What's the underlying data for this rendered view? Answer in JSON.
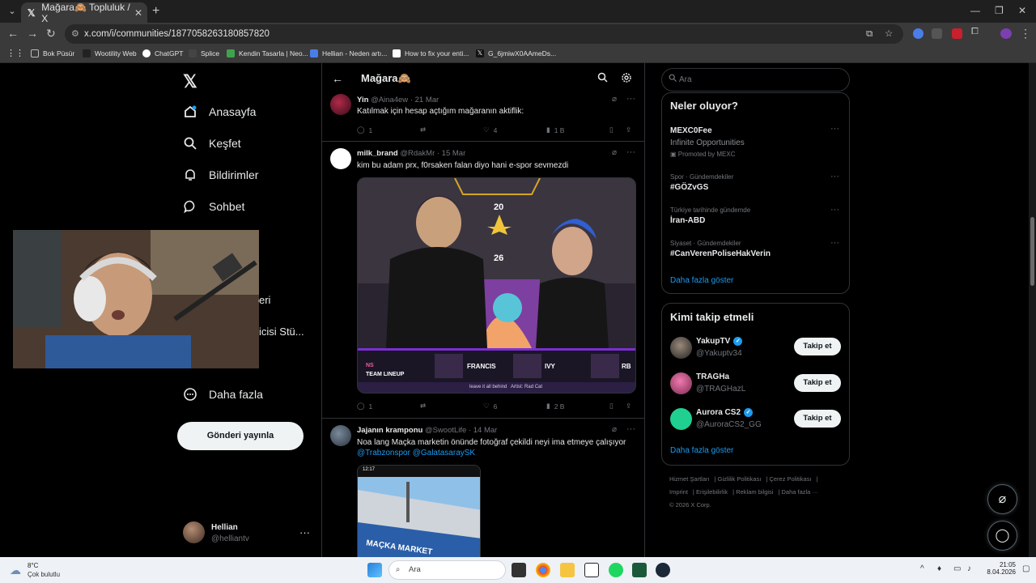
{
  "browser": {
    "tab_title": "Mağara🙈 Topluluk / X",
    "url": "x.com/i/communities/1877058263180857820",
    "bookmarks": [
      "Bok Püsür",
      "Wootility Web",
      "ChatGPT",
      "Splice",
      "Kendin Tasarla | Neo...",
      "Hellian - Neden artı...",
      "How to fix your enti...",
      "G_6jmiwX0AAmeDs..."
    ]
  },
  "sidebar": {
    "logo": "𝕏",
    "items": [
      {
        "label": "Anasayfa",
        "icon": "home-icon"
      },
      {
        "label": "Keşfet",
        "icon": "search-icon"
      },
      {
        "label": "Bildirimler",
        "icon": "bell-icon"
      },
      {
        "label": "Sohbet",
        "icon": "chat-icon"
      },
      {
        "label": "Daha fazla",
        "icon": "more-circle-icon"
      }
    ],
    "obscured_fragments": [
      "eri",
      "icisi Stü..."
    ],
    "post_button": "Gönderi yayınla",
    "profile": {
      "name": "Hellian",
      "handle": "@helliantv",
      "more": "···"
    }
  },
  "feed": {
    "title": "Mağara🙈",
    "tweets": [
      {
        "name": "Yin",
        "handle": "@Aina4ew",
        "date": "· 21 Mar",
        "text": "Katılmak için hesap açtığım mağaranın aktiflik:",
        "replies": "1",
        "likes": "4",
        "views": "1 B"
      },
      {
        "name": "milk_brand",
        "handle": "@RdakMr",
        "date": "· 15 Mar",
        "text": "kim bu adam prx, f0rsaken falan diyo hani e-spor sevmezdi",
        "media": {
          "score_top": "20",
          "score_bottom": "26",
          "team_label": "TEAM LINEUP",
          "team_code": "NS",
          "players": [
            "FRANCIS",
            "IVY",
            "RB"
          ],
          "ticker": "leave it all behind   Artist: Rad Cat"
        },
        "replies": "1",
        "likes": "6",
        "views": "2 B"
      },
      {
        "name": "Jajanın kramponu",
        "handle": "@SwootLife",
        "date": "· 14 Mar",
        "text": "Noa lang Maçka marketin önünde fotoğraf çekildi neyi ima etmeye çalışıyor",
        "mentions": "@Trabzonspor @GalatasaraySK",
        "media": {
          "status_time": "12:17",
          "sign": "MAÇKA MARKET"
        }
      }
    ]
  },
  "right": {
    "search_placeholder": "Ara",
    "trends_title": "Neler oluyor?",
    "trends": [
      {
        "meta": "",
        "name": "MEXC0Fee",
        "sub": "Infinite Opportunities",
        "promo": "Promoted by MEXC"
      },
      {
        "meta": "Spor · Gündemdekiler",
        "name": "#GÖZvGS"
      },
      {
        "meta": "Türkiye tarihinde gündemde",
        "name": "İran-ABD"
      },
      {
        "meta": "Siyaset · Gündemdekiler",
        "name": "#CanVerenPoliseHakVerin"
      }
    ],
    "trends_show_more": "Daha fazla göster",
    "follow_title": "Kimi takip etmeli",
    "follow": [
      {
        "name": "YakupTV",
        "handle": "@Yakuptv34",
        "verified": true,
        "button": "Takip et"
      },
      {
        "name": "TRAGHa",
        "handle": "@TRAGHazL",
        "verified": false,
        "button": "Takip et"
      },
      {
        "name": "Aurora CS2",
        "handle": "@AuroraCS2_GG",
        "verified": true,
        "button": "Takip et"
      }
    ],
    "follow_show_more": "Daha fazla göster",
    "footer": [
      "Hizmet Şartları",
      "Gizlilik Politikası",
      "Çerez Politikası",
      "Imprint",
      "Erişilebilirlik",
      "Reklam bilgisi",
      "Daha fazla ···",
      "© 2026 X Corp."
    ]
  },
  "taskbar": {
    "weather_temp": "8°C",
    "weather_desc": "Çok bulutlu",
    "search_placeholder": "Ara",
    "time": "21:05",
    "date": "8.04.2026"
  },
  "colors": {
    "accent": "#1d9bf0",
    "border": "#2f3336",
    "muted": "#71767b"
  }
}
